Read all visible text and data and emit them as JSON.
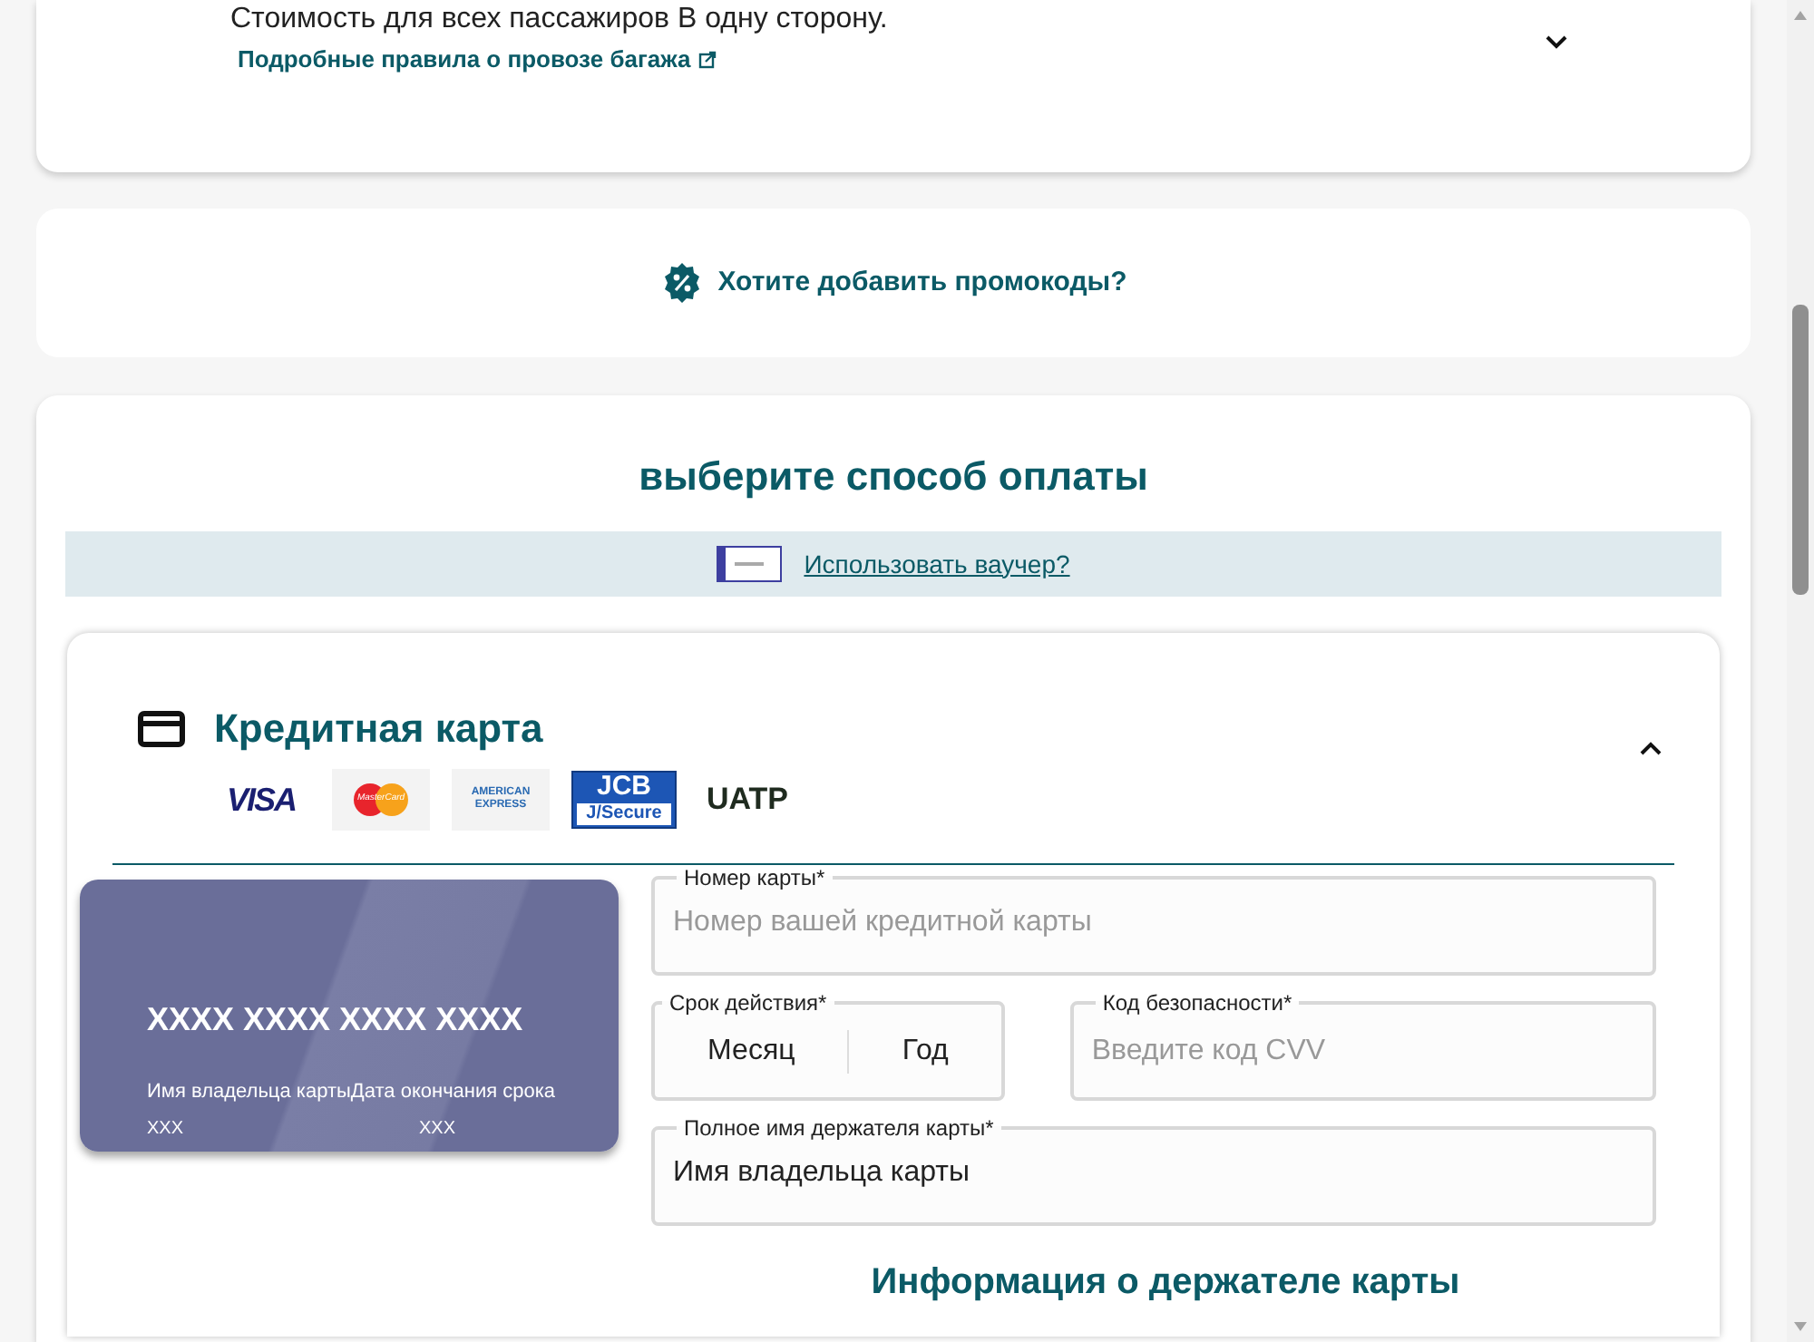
{
  "baggage": {
    "price_note": "Стоимость для всех пассажиров В одну сторону.",
    "rules_link": "Подробные правила о провозе багажа",
    "expanded": false
  },
  "promo": {
    "link": "Хотите добавить промокоды?"
  },
  "payment": {
    "title": "выберите способ оплаты",
    "voucher_link": "Использовать ваучер?",
    "credit_card": {
      "title": "Кредитная карта",
      "expanded": true,
      "brands": [
        {
          "kind": "visa",
          "label": "VISA"
        },
        {
          "kind": "mastercard",
          "label": "MasterCard"
        },
        {
          "kind": "amex",
          "label": "AMERICAN EXPRESS"
        },
        {
          "kind": "jcb",
          "label": "JCB",
          "sublabel": "J/Secure"
        },
        {
          "kind": "uatp",
          "label": "UATP"
        }
      ],
      "preview": {
        "number": "XXXX XXXX XXXX XXXX",
        "name_label": "Имя владельца карты",
        "expiry_label": "Дата окончания срока",
        "name_value": "XXX",
        "expiry_value": "XXX"
      },
      "card_number": {
        "label": "Номер карты*",
        "placeholder": "Номер вашей кредитной карты"
      },
      "expiry": {
        "label": "Срок действия*",
        "month": "Месяц",
        "year": "Год"
      },
      "cvv": {
        "label": "Код безопасности*",
        "placeholder": "Введите код CVV"
      },
      "holder_name": {
        "label": "Полное имя держателя карты*",
        "value": "Имя владельца карты"
      }
    },
    "holder_heading": "Информация о держателе карты"
  }
}
